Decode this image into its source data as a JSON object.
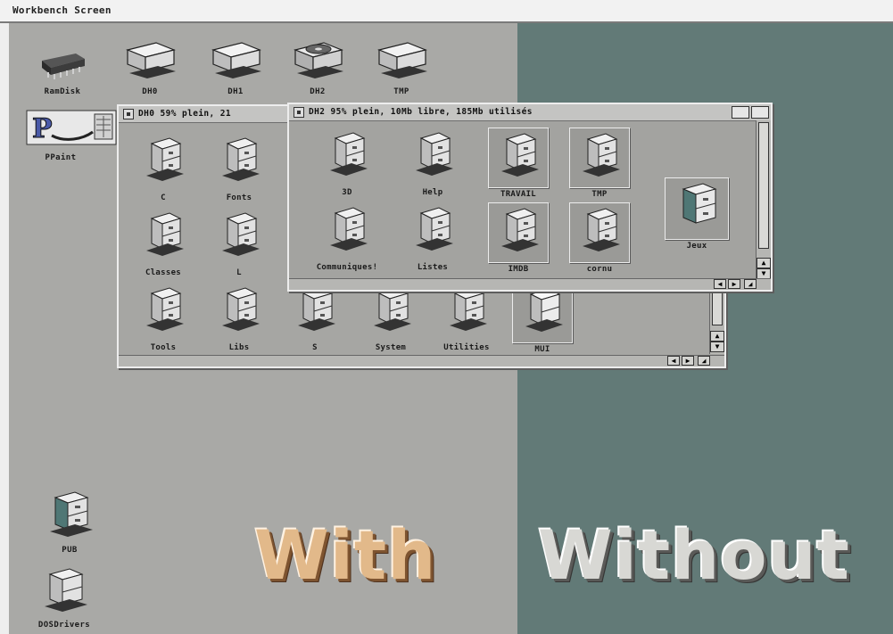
{
  "screen": {
    "title": "Workbench Screen"
  },
  "desktop_icons": [
    {
      "label": "RamDisk",
      "icon": "ramdisk-icon"
    },
    {
      "label": "DH0",
      "icon": "harddisk-icon"
    },
    {
      "label": "DH1",
      "icon": "harddisk-icon"
    },
    {
      "label": "DH2",
      "icon": "harddisk-open-icon"
    },
    {
      "label": "TMP",
      "icon": "harddisk-icon"
    },
    {
      "label": "PPaint",
      "icon": "ppaint-app-icon"
    },
    {
      "label": "PUB",
      "icon": "drawer-icon"
    },
    {
      "label": "DOSDrivers",
      "icon": "drawer-icon"
    }
  ],
  "window_dh0": {
    "title": "DH0 59% plein, 21",
    "drawers": [
      "C",
      "Fonts",
      "Classes",
      "L",
      "Tools",
      "Libs",
      "S",
      "System",
      "Utilities",
      "MUI"
    ]
  },
  "window_dh2": {
    "title": "DH2 95% plein, 10Mb libre, 185Mb utilisés",
    "drawers": [
      "3D",
      "Help",
      "TRAVAIL",
      "TMP",
      "Communiques!",
      "Listes",
      "IMDB",
      "cornu",
      "Jeux"
    ]
  },
  "comparison": {
    "with_label": "With",
    "without_label": "Without"
  },
  "colors": {
    "left_bg": "#a9a9a6",
    "right_bg": "#627a77",
    "with_text": "#e2b98a",
    "without_text": "#d8d8d4"
  }
}
